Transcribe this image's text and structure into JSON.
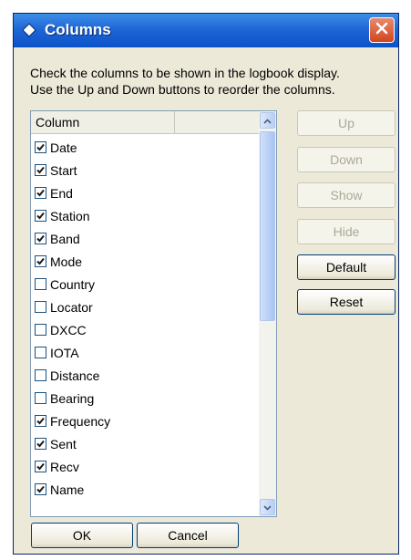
{
  "window": {
    "title": "Columns"
  },
  "description": {
    "line1": "Check the columns to be shown in the logbook display.",
    "line2": "Use the Up and Down buttons to reorder the columns."
  },
  "list": {
    "header": "Column",
    "items": [
      {
        "label": "Date",
        "checked": true
      },
      {
        "label": "Start",
        "checked": true
      },
      {
        "label": "End",
        "checked": true
      },
      {
        "label": "Station",
        "checked": true
      },
      {
        "label": "Band",
        "checked": true
      },
      {
        "label": "Mode",
        "checked": true
      },
      {
        "label": "Country",
        "checked": false
      },
      {
        "label": "Locator",
        "checked": false
      },
      {
        "label": "DXCC",
        "checked": false
      },
      {
        "label": "IOTA",
        "checked": false
      },
      {
        "label": "Distance",
        "checked": false
      },
      {
        "label": "Bearing",
        "checked": false
      },
      {
        "label": "Frequency",
        "checked": true
      },
      {
        "label": "Sent",
        "checked": true
      },
      {
        "label": "Recv",
        "checked": true
      },
      {
        "label": "Name",
        "checked": true
      }
    ]
  },
  "buttons": {
    "up": "Up",
    "down": "Down",
    "show": "Show",
    "hide": "Hide",
    "default": "Default",
    "reset": "Reset",
    "ok": "OK",
    "cancel": "Cancel"
  },
  "icons": {
    "title": "diamond-icon",
    "close": "close-icon",
    "scroll_up": "scroll-up-arrow-icon",
    "scroll_down": "scroll-down-arrow-icon",
    "check": "check-icon"
  },
  "colors": {
    "titlebar": "#1f67d6",
    "close": "#d2451e",
    "dialog_bg": "#ece9d8",
    "disabled_text": "#aca899"
  }
}
